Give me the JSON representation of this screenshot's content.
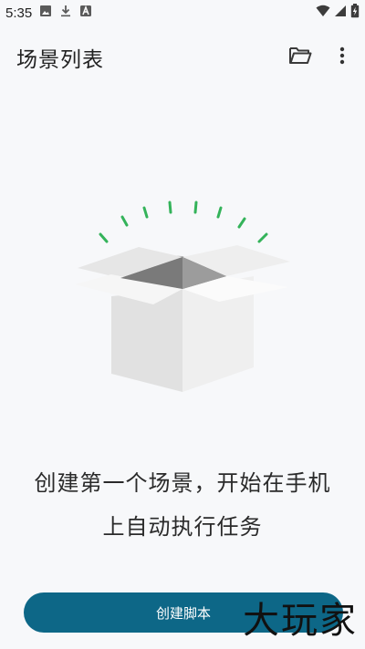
{
  "status_bar": {
    "time": "5:35",
    "icons": [
      "image-icon",
      "download-icon",
      "a-icon",
      "wifi-icon",
      "signal-icon",
      "battery-charging-icon"
    ]
  },
  "app_bar": {
    "title": "场景列表",
    "icons": [
      "folder-open-icon",
      "more-vert-icon"
    ]
  },
  "empty_state": {
    "line1": "创建第一个场景，开始在手机",
    "line2": "上自动执行任务"
  },
  "primary_button": {
    "label": "创建脚本"
  },
  "watermark": {
    "text": "大玩家"
  },
  "colors": {
    "button_bg": "#0d6787",
    "spark": "#34b35a",
    "background": "#f7f8fa"
  }
}
